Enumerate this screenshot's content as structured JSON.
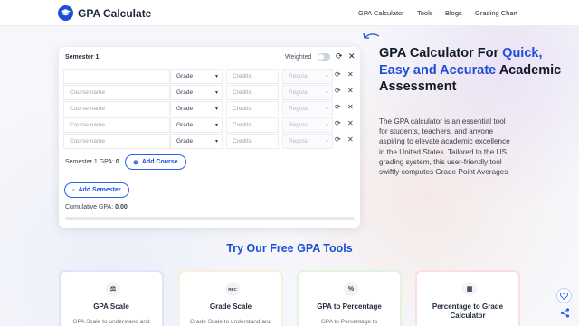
{
  "header": {
    "logo_text": "GPA Calculate",
    "nav": [
      "GPA Calculator",
      "Tools",
      "Blogs",
      "Grading Chart"
    ]
  },
  "calculator": {
    "semester_title": "Semester 1",
    "weighted_label": "Weighted",
    "weighted_on": false,
    "header_row": {
      "course": "",
      "grade": "Grade",
      "credits": "Credits",
      "type": "Regular"
    },
    "rows": [
      {
        "course_placeholder": "Course name",
        "grade": "Grade",
        "credits_placeholder": "Credits",
        "type": "Regular"
      },
      {
        "course_placeholder": "Course name",
        "grade": "Grade",
        "credits_placeholder": "Credits",
        "type": "Regular"
      },
      {
        "course_placeholder": "Course name",
        "grade": "Grade",
        "credits_placeholder": "Credits",
        "type": "Regular"
      },
      {
        "course_placeholder": "Course name",
        "grade": "Grade",
        "credits_placeholder": "Credits",
        "type": "Regular"
      }
    ],
    "semester_gpa_label": "Semester 1 GPA:",
    "semester_gpa_value": "0",
    "add_course_label": "Add Course",
    "add_semester_label": "Add Semester",
    "cumulative_gpa_label": "Cumulative GPA:",
    "cumulative_gpa_value": "0.00"
  },
  "hero": {
    "title_pre": "GPA Calculator For ",
    "title_highlight": "Quick, Easy and Accurate",
    "title_post": " Academic Assessment",
    "description": "The GPA calculator is an essential tool for students, teachers, and anyone aspiring to elevate academic excellence in the United States. Tailored to the US grading system, this user-friendly tool swiftly computes Grade Point Averages"
  },
  "tools": {
    "title": "Try Our Free GPA Tools",
    "cards": [
      {
        "name": "GPA Scale",
        "desc": "GPA Scale to understand and",
        "icon": "scale-icon",
        "border": "#dfe3fb"
      },
      {
        "name": "Grade Scale",
        "desc": "Grade Scale to understand and",
        "icon": "grade-icon",
        "icon_text": "REC",
        "border": "#fbeedb"
      },
      {
        "name": "GPA to Percentage",
        "desc": "GPA to Percentage to",
        "icon": "percent-icon",
        "icon_text": "%",
        "border": "#e2f3dd"
      },
      {
        "name": "Percentage to Grade Calculator",
        "desc": "",
        "icon": "calculator-icon",
        "border": "#fbdde2"
      }
    ]
  },
  "colors": {
    "accent": "#1d4ed8",
    "text": "#1f2937",
    "muted": "#9ca3af"
  }
}
